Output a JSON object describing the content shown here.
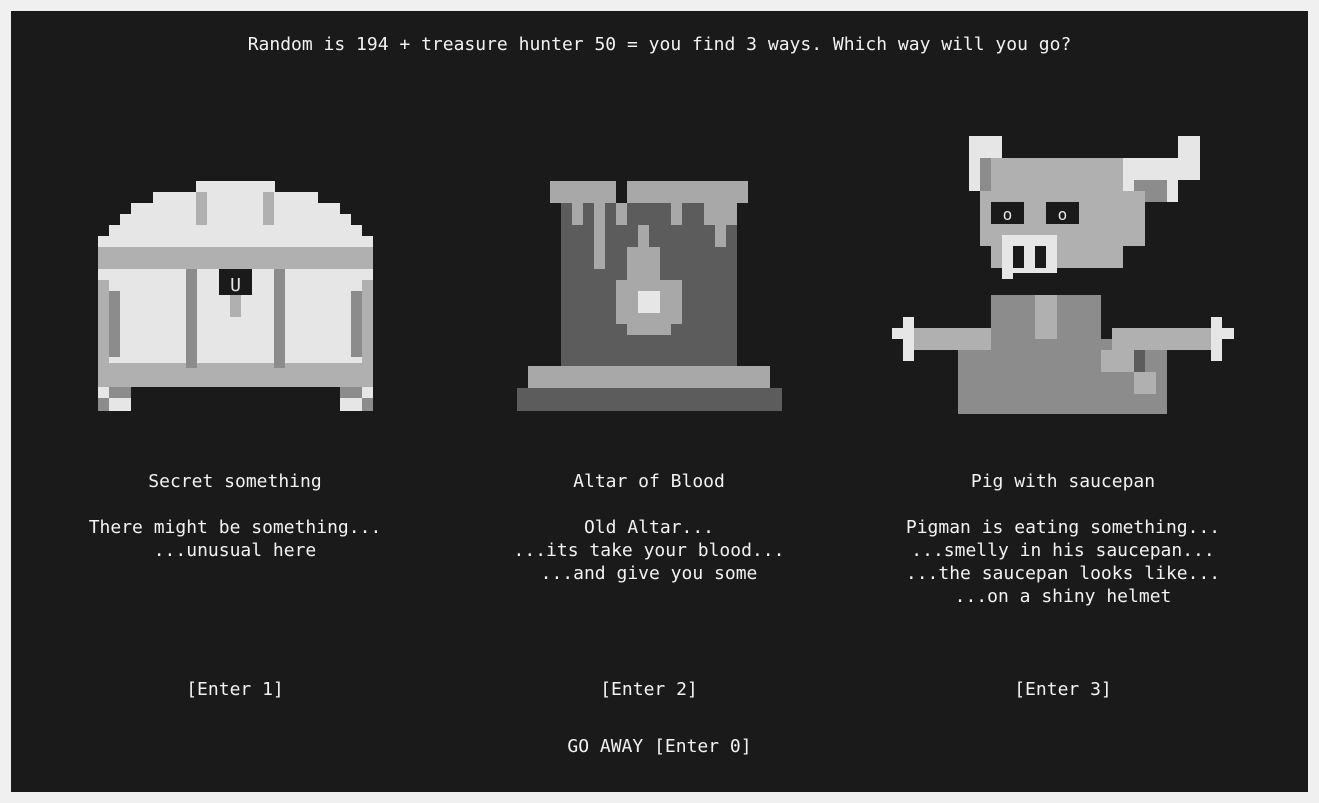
{
  "status_text": "Random is 194 + treasure hunter 50 = you find 3 ways. Which way will you go?",
  "options": [
    {
      "art": "treasure-chest-icon",
      "title": "Secret something",
      "description": "There might be something...\n...unusual here",
      "enter_label": "[Enter 1]"
    },
    {
      "art": "altar-icon",
      "title": "Altar of Blood",
      "description": "Old Altar...\n...its take your blood...\n...and give you some",
      "enter_label": "[Enter 2]"
    },
    {
      "art": "pigman-icon",
      "title": "Pig with saucepan",
      "description": "Pigman is eating something...\n...smelly in his saucepan...\n...the saucepan looks like...\n...on a shiny helmet",
      "enter_label": "[Enter 3]"
    }
  ],
  "chest_lock_glyph": "U",
  "pig_eye_glyph": "o",
  "go_away_label": "GO AWAY [Enter 0]",
  "colors": {
    "background": "#1a1a1a",
    "text": "#f2f2f2",
    "frame": "#f0f0f0"
  }
}
